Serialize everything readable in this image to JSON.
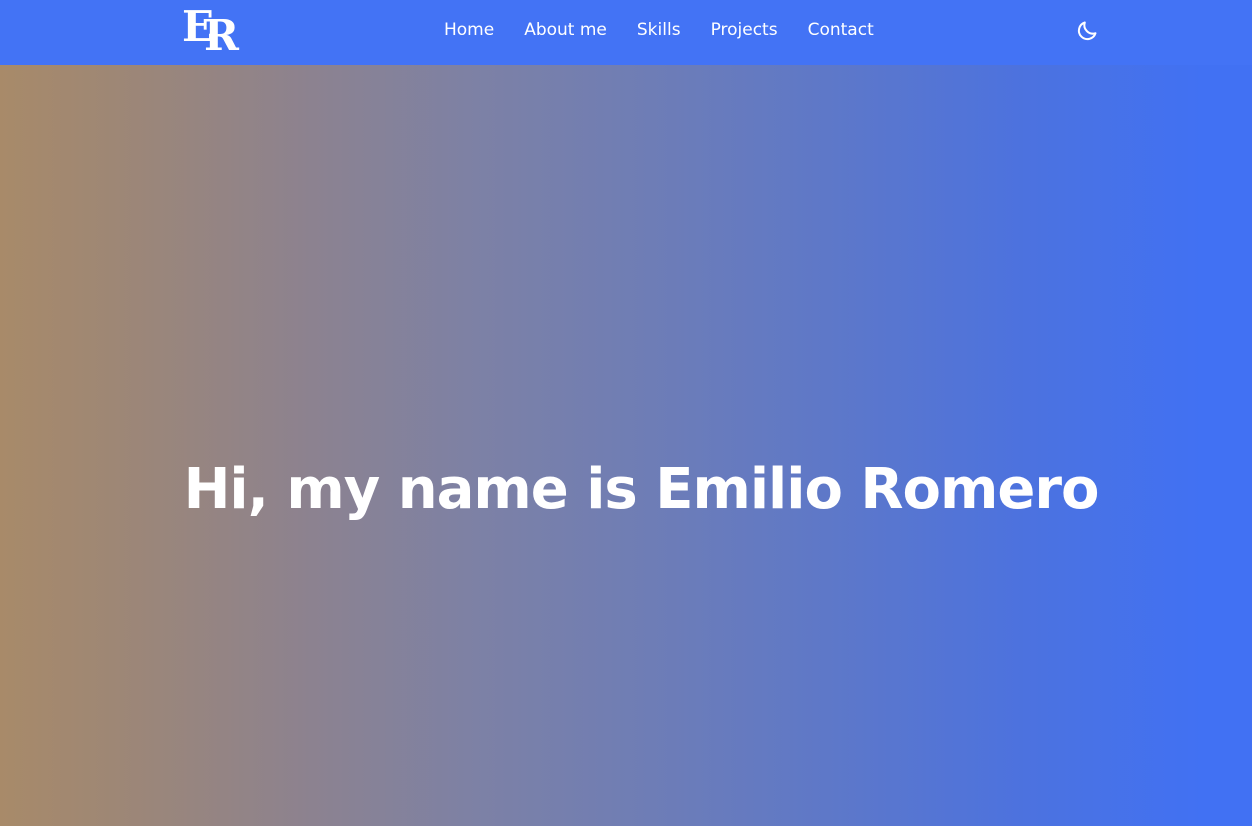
{
  "header": {
    "logo_text": "ER",
    "nav": [
      {
        "label": "Home"
      },
      {
        "label": "About me"
      },
      {
        "label": "Skills"
      },
      {
        "label": "Projects"
      },
      {
        "label": "Contact"
      }
    ],
    "theme_toggle_icon": "moon-icon"
  },
  "hero": {
    "title": "Hi, my name is Emilio Romero"
  },
  "colors": {
    "navbar": "#4373f5",
    "gradient_left": "#a88a69",
    "gradient_right": "#4171f3",
    "text": "#ffffff"
  }
}
